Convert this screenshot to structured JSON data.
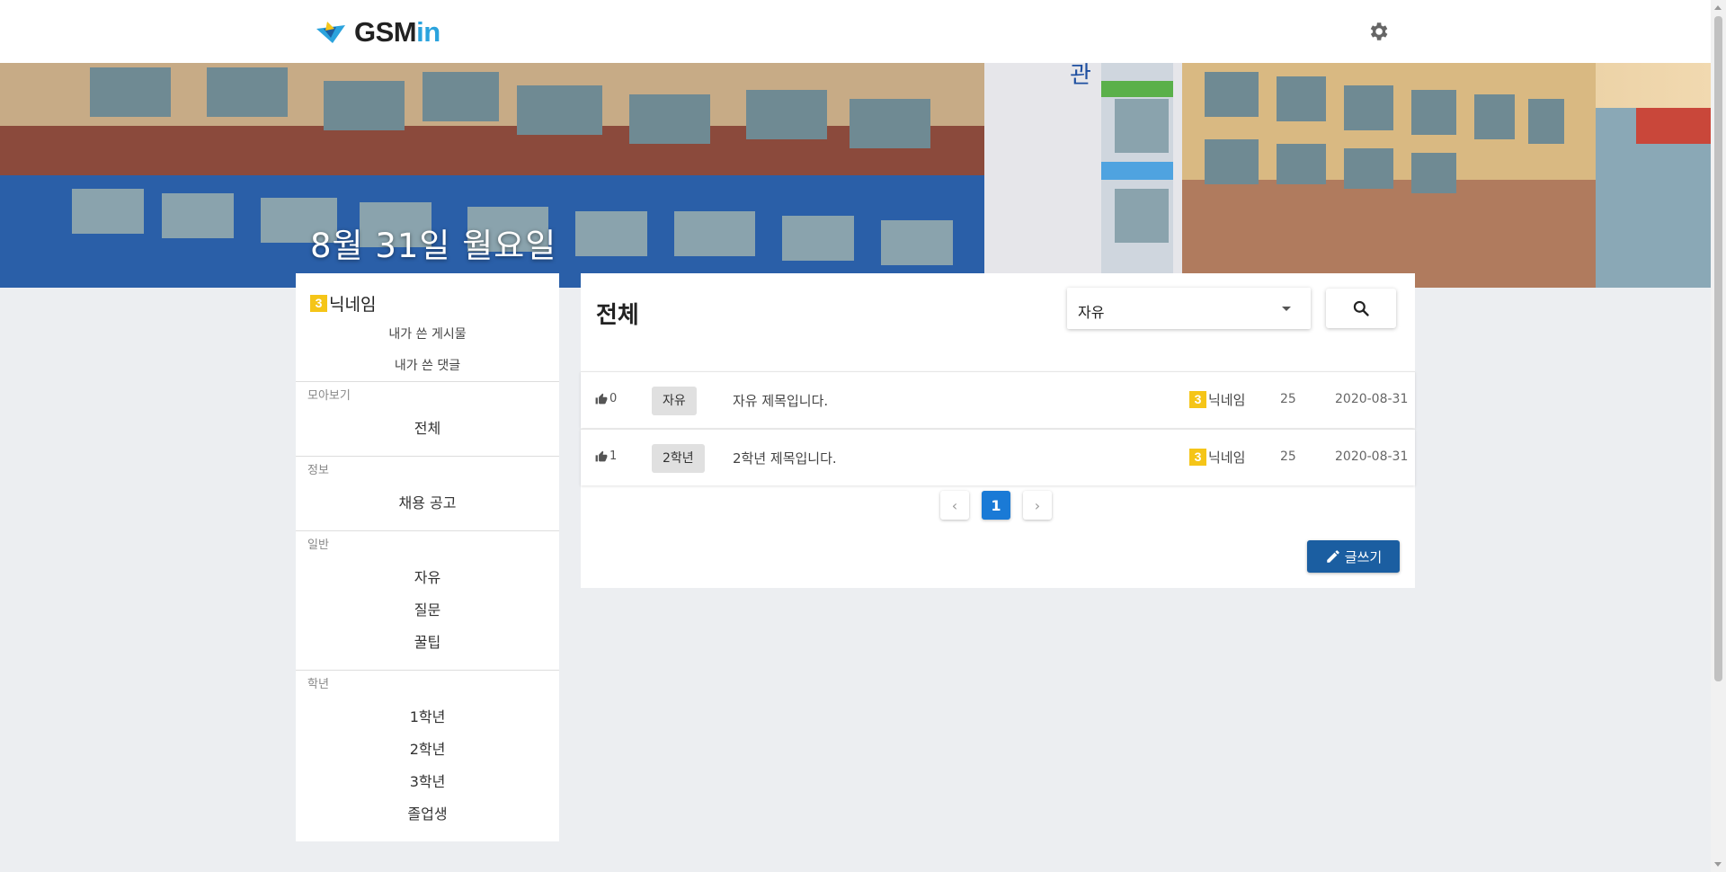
{
  "header": {
    "logo_prefix": "GSM",
    "logo_accent": "in"
  },
  "hero": {
    "date": "8월 31일 월요일"
  },
  "sidebar": {
    "profile": {
      "grade": "3",
      "nickname": "닉네임"
    },
    "my_posts": "내가 쓴 게시물",
    "my_comments": "내가 쓴 댓글",
    "sections": [
      {
        "caption": "모아보기",
        "items": [
          "전체"
        ]
      },
      {
        "caption": "정보",
        "items": [
          "채용 공고"
        ]
      },
      {
        "caption": "일반",
        "items": [
          "자유",
          "질문",
          "꿀팁"
        ]
      },
      {
        "caption": "학년",
        "items": [
          "1학년",
          "2학년",
          "3학년",
          "졸업생"
        ]
      }
    ]
  },
  "main": {
    "title": "전체",
    "category_select": "자유",
    "posts": [
      {
        "likes": "0",
        "category": "자유",
        "title": "자유 제목입니다.",
        "author_grade": "3",
        "author": "닉네임",
        "views": "25",
        "date": "2020-08-31"
      },
      {
        "likes": "1",
        "category": "2학년",
        "title": "2학년 제목입니다.",
        "author_grade": "3",
        "author": "닉네임",
        "views": "25",
        "date": "2020-08-31"
      }
    ],
    "pagination": {
      "prev": "‹",
      "current": "1",
      "next": "›"
    },
    "write_button": "글쓰기"
  },
  "colors": {
    "accent": "#1b5ea1",
    "brand_accent": "#2ba3dd",
    "badge": "#f5c518",
    "page_active": "#1a7ad6"
  },
  "icons": {
    "settings": "gear-icon",
    "search": "search-icon",
    "like": "thumb-up-icon",
    "write": "pencil-icon",
    "select": "caret-down-icon"
  }
}
